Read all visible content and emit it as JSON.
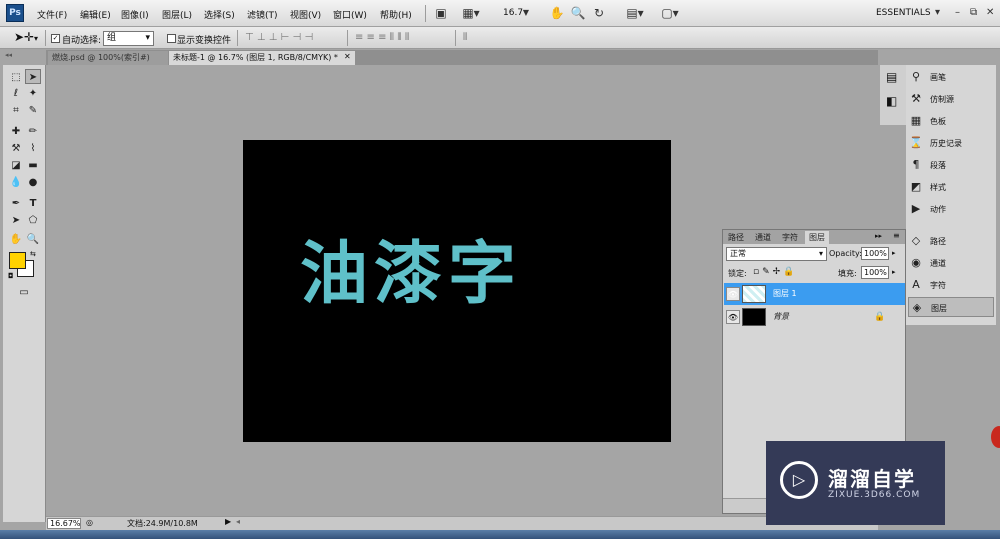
{
  "app": {
    "logo": "Ps"
  },
  "menu": [
    "文件(F)",
    "编辑(E)",
    "图像(I)",
    "图层(L)",
    "选择(S)",
    "滤镜(T)",
    "视图(V)",
    "窗口(W)",
    "帮助(H)"
  ],
  "menubar": {
    "zoom": "16.7",
    "workspace": "ESSENTIALS",
    "icons": [
      "mini-bridge-icon",
      "view-extras-icon",
      "zoom-level-dropdown",
      "hand-icon",
      "zoom-icon",
      "rotate-view-icon",
      "arrange-documents-icon",
      "screen-mode-icon"
    ]
  },
  "options": {
    "auto_select_label": "自动选择:",
    "auto_select_value": "组",
    "show_transform_label": "显示变换控件"
  },
  "tabs": [
    {
      "label": "燃烧.psd @ 100%(索引#)",
      "active": false
    },
    {
      "label": "未标题-1 @ 16.7% (图层 1, RGB/8/CMYK) *",
      "active": true
    }
  ],
  "colors": {
    "foreground": "#ffd200",
    "background": "#ffffff",
    "text_fill": "#5fc0c9",
    "canvas": "#000000",
    "accent_select": "#3b9cf0"
  },
  "canvas": {
    "text": "油漆字"
  },
  "status": {
    "zoom": "16.67%",
    "doc": "文档:24.9M/10.8M"
  },
  "dock": [
    {
      "label": "画笔",
      "icon": "brush-icon"
    },
    {
      "label": "仿制源",
      "icon": "clone-source-icon"
    },
    {
      "label": "色板",
      "icon": "swatches-icon"
    },
    {
      "label": "历史记录",
      "icon": "history-icon"
    },
    {
      "label": "段落",
      "icon": "paragraph-icon"
    },
    {
      "label": "样式",
      "icon": "styles-icon"
    },
    {
      "label": "动作",
      "icon": "actions-icon"
    },
    {
      "label": "路径",
      "icon": "paths-icon"
    },
    {
      "label": "通道",
      "icon": "channels-icon"
    },
    {
      "label": "字符",
      "icon": "character-icon"
    },
    {
      "label": "图层",
      "icon": "layers-icon"
    }
  ],
  "layers_panel": {
    "tabs": [
      "路径",
      "通道",
      "字符",
      "图层"
    ],
    "blend_mode": "正常",
    "opacity_label": "Opacity:",
    "opacity": "100%",
    "lock_label": "锁定:",
    "fill_label": "填充:",
    "fill": "100%",
    "layers": [
      {
        "name": "图层 1",
        "selected": true
      },
      {
        "name": "背景",
        "selected": false
      }
    ]
  },
  "watermark": {
    "title": "溜溜自学",
    "url": "ZIXUE.3D66.COM"
  }
}
